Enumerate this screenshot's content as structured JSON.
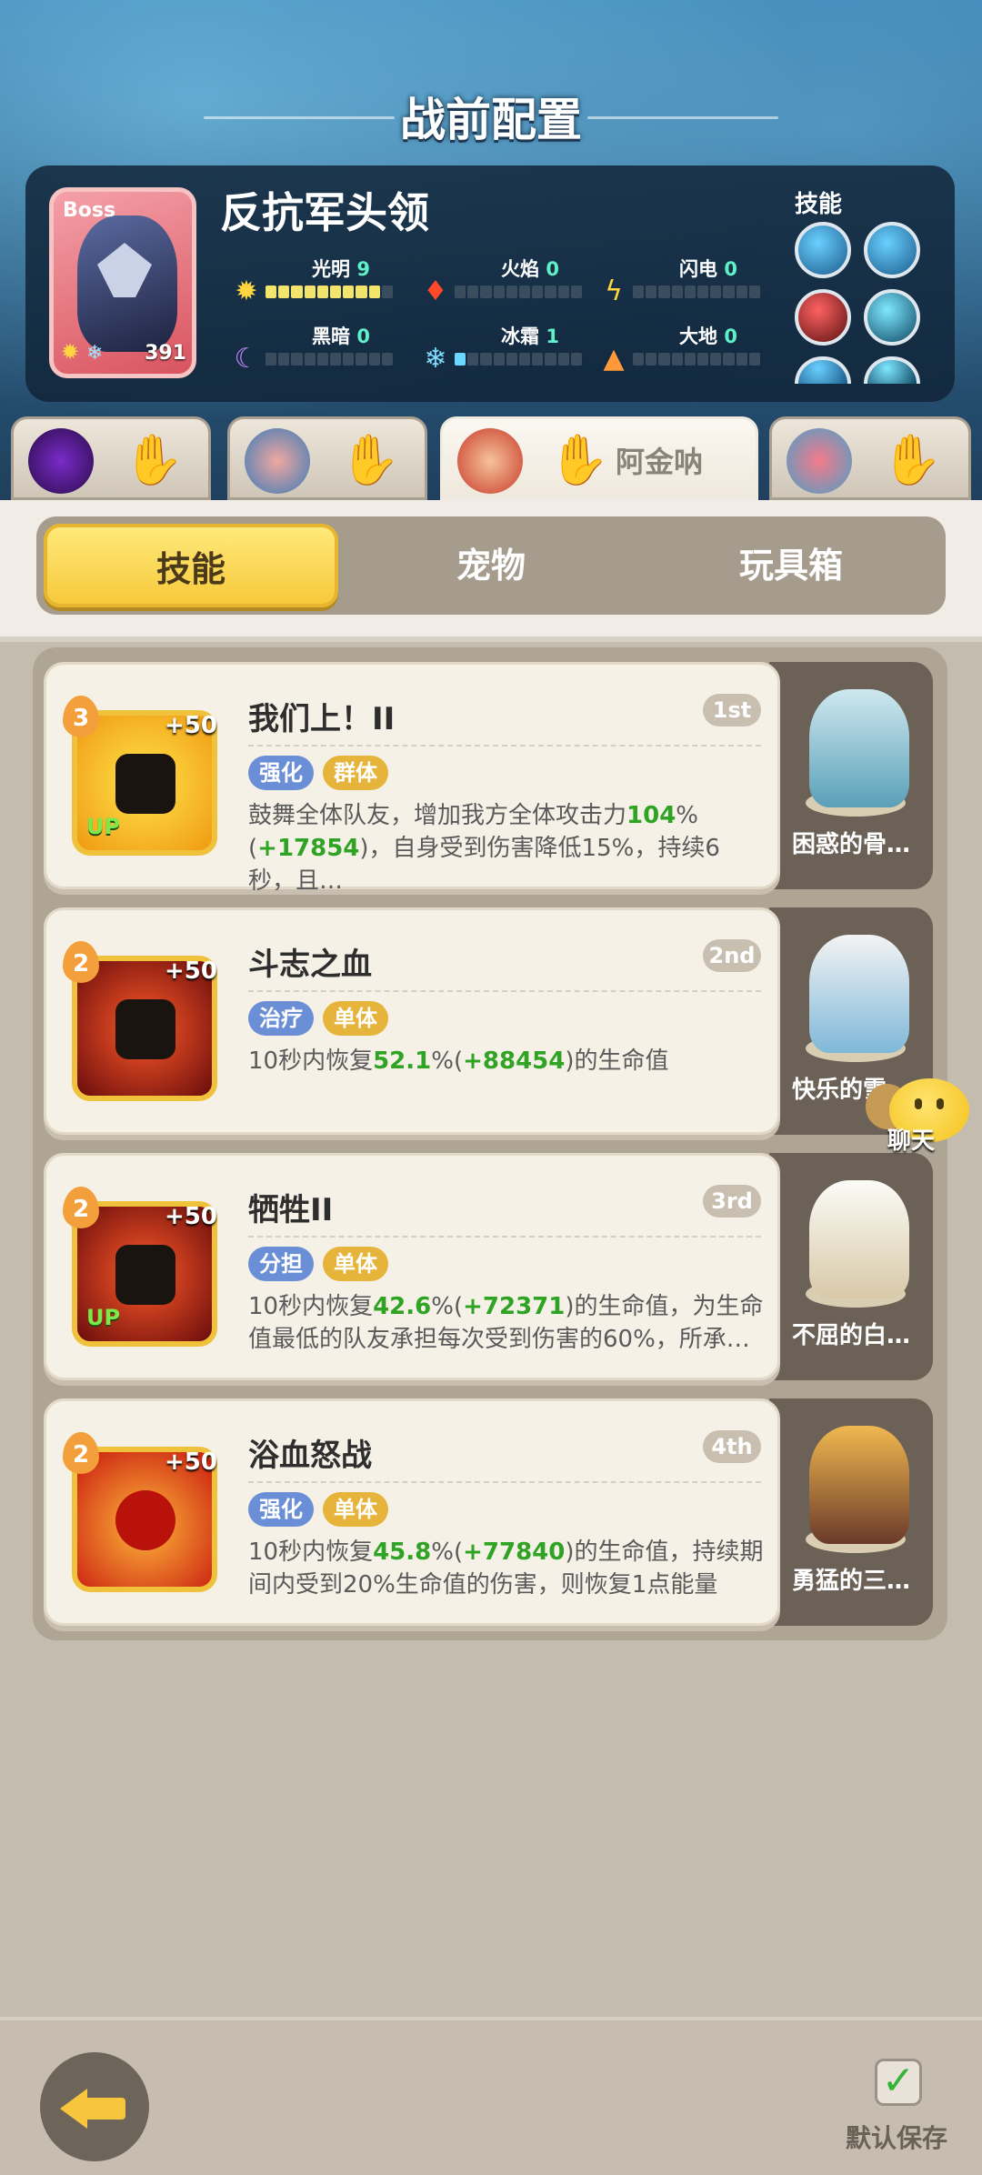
{
  "header": {
    "title": "战前配置"
  },
  "boss": {
    "tag": "Boss",
    "name": "反抗军头领",
    "level": "391",
    "elements": [
      {
        "name": "光明",
        "value": "9",
        "icon": "sun-icon",
        "filled": 9
      },
      {
        "name": "火焰",
        "value": "0",
        "icon": "flame-icon",
        "filled": 0
      },
      {
        "name": "闪电",
        "value": "0",
        "icon": "lightning-icon",
        "filled": 0
      },
      {
        "name": "黑暗",
        "value": "0",
        "icon": "moon-icon",
        "filled": 0
      },
      {
        "name": "冰霜",
        "value": "1",
        "icon": "snowflake-icon",
        "filled": 1
      },
      {
        "name": "大地",
        "value": "0",
        "icon": "mountain-icon",
        "filled": 0
      }
    ],
    "skills_label": "技能"
  },
  "heroes": [
    {
      "icon": "hero-purple-avatar"
    },
    {
      "icon": "hero-blue-avatar"
    },
    {
      "icon": "hero-red-hair-avatar",
      "name": "阿金呐",
      "active": true
    },
    {
      "icon": "hero-pink-avatar"
    }
  ],
  "tabs": [
    {
      "label": "技能",
      "active": true
    },
    {
      "label": "宠物"
    },
    {
      "label": "玩具箱"
    }
  ],
  "skills": [
    {
      "level": "3",
      "plus": "+50",
      "up": "UP",
      "name": "我们上！II",
      "order": "1st",
      "tags": [
        "强化",
        "群体"
      ],
      "desc_a": "鼓舞全体队友，增加我方全体攻击力",
      "v1": "104",
      "desc_b": "%(",
      "v2": "+17854",
      "desc_c": ")，自身受到伤害降低15%，持续6秒，且…",
      "pet": "困惑的骨…"
    },
    {
      "level": "2",
      "plus": "+50",
      "up": "",
      "name": "斗志之血",
      "order": "2nd",
      "tags": [
        "治疗",
        "单体"
      ],
      "desc_a": "10秒内恢复",
      "v1": "52.1",
      "desc_b": "%(",
      "v2": "+88454",
      "desc_c": ")的生命值",
      "pet": "快乐的雪…"
    },
    {
      "level": "2",
      "plus": "+50",
      "up": "UP",
      "name": "牺牲II",
      "order": "3rd",
      "tags": [
        "分担",
        "单体"
      ],
      "desc_a": "10秒内恢复",
      "v1": "42.6",
      "desc_b": "%(",
      "v2": "+72371",
      "desc_c": ")的生命值，为生命值最低的队友承担每次受到伤害的60%，所承…",
      "pet": "不屈的白…"
    },
    {
      "level": "2",
      "plus": "+50",
      "up": "",
      "name": "浴血怒战",
      "order": "4th",
      "tags": [
        "强化",
        "单体"
      ],
      "desc_a": "10秒内恢复",
      "v1": "45.8",
      "desc_b": "%(",
      "v2": "+77840",
      "desc_c": ")的生命值，持续期间内受到20%生命值的伤害，则恢复1点能量",
      "pet": "勇猛的三…"
    }
  ],
  "chat": {
    "label": "聊天"
  },
  "footer": {
    "save_label": "默认保存"
  },
  "colors": {
    "accent": "#f7c93b",
    "value_green": "#2fa324"
  }
}
